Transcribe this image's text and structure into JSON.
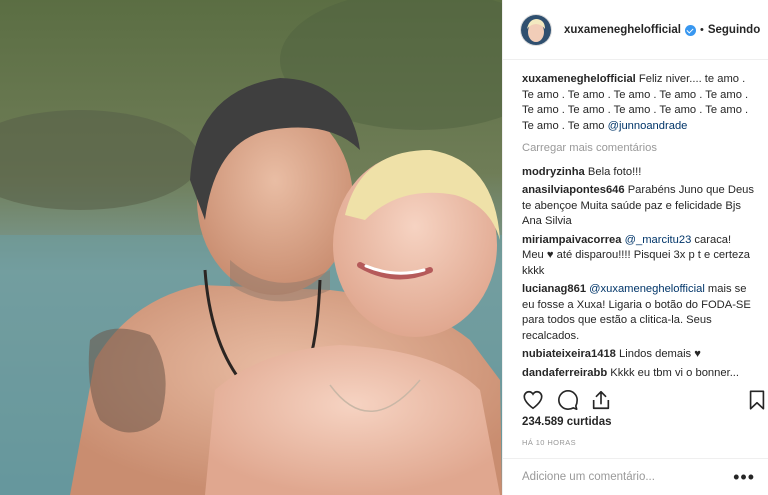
{
  "post": {
    "username": "xuxameneghelofficial",
    "separator": "•",
    "follow_label": "Seguindo",
    "caption_text": "Feliz niver.... te amo . Te amo . Te amo . Te amo . Te amo . Te amo . Te amo . Te amo . Te amo . Te amo . Te amo . Te amo . Te amo",
    "caption_mention": "@junnoandrade",
    "load_more": "Carregar mais comentários",
    "comments": [
      {
        "user": "modryzinha",
        "text": "Bela foto!!!"
      },
      {
        "user": "anasilviapontes646",
        "text": "Parabéns Juno que Deus te abençoe Muita saúde paz e felicidade Bjs Ana Silvia"
      },
      {
        "user": "miriampaivacorrea",
        "mention": "@_marcitu23",
        "text": " caraca! Meu ♥ até disparou!!!! Pisquei 3x p t e certeza kkkk"
      },
      {
        "user": "lucianag861",
        "mention": "@xuxameneghelofficial",
        "text": " mais se eu fosse a Xuxa! Ligaria o botão do FODA-SE para todos que estão a clitica-la. Seus recalcados."
      },
      {
        "user": "nubiateixeira1418",
        "text": "Lindos demais ♥"
      },
      {
        "user": "dandaferreirabb",
        "text": "Kkkk eu tbm vi o bonner..."
      }
    ],
    "likes": "234.589 curtidas",
    "time": "HÁ 10 HORAS",
    "add_comment_placeholder": "Adicione um comentário...",
    "more_options": "•••",
    "icons": {
      "like": "heart-outline-icon",
      "comment": "speech-bubble-icon",
      "share": "share-arrow-icon",
      "save": "bookmark-icon",
      "verified": "verified-badge-icon"
    },
    "colors": {
      "mention": "#003569",
      "verified": "#3897f0",
      "muted": "#999999",
      "text": "#262626"
    }
  }
}
